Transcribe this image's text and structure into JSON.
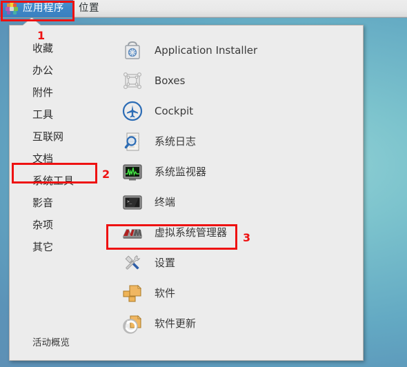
{
  "topbar": {
    "apps_menu": {
      "label": "应用程序",
      "icon": "pinwheel-icon",
      "active": true
    },
    "places_menu": {
      "label": "位置",
      "active": false
    }
  },
  "menu_panel": {
    "categories": [
      {
        "label": "收藏"
      },
      {
        "label": "办公"
      },
      {
        "label": "附件"
      },
      {
        "label": "工具"
      },
      {
        "label": "互联网"
      },
      {
        "label": "文档"
      },
      {
        "label": "系统工具",
        "highlighted": true
      },
      {
        "label": "影音"
      },
      {
        "label": "杂项"
      },
      {
        "label": "其它"
      }
    ],
    "applications": [
      {
        "label": "Application Installer",
        "icon": "software-bag-icon"
      },
      {
        "label": "Boxes",
        "icon": "boxes-icon"
      },
      {
        "label": "Cockpit",
        "icon": "cockpit-plane-icon"
      },
      {
        "label": "系统日志",
        "icon": "system-logs-icon"
      },
      {
        "label": "系统监视器",
        "icon": "system-monitor-icon"
      },
      {
        "label": "终端",
        "icon": "terminal-icon"
      },
      {
        "label": "虚拟系统管理器",
        "icon": "virt-manager-icon",
        "highlighted": true
      },
      {
        "label": "设置",
        "icon": "settings-tools-icon"
      },
      {
        "label": "软件",
        "icon": "software-packages-icon"
      },
      {
        "label": "软件更新",
        "icon": "software-update-icon"
      }
    ],
    "activities_label": "活动概览"
  },
  "annotations": [
    {
      "number": "1"
    },
    {
      "number": "2"
    },
    {
      "number": "3"
    }
  ],
  "colors": {
    "annotation_red": "#ee1111",
    "menu_active_blue": "#3d86c6",
    "panel_bg": "#ececec",
    "desktop_teal": "#7cc3cd"
  }
}
